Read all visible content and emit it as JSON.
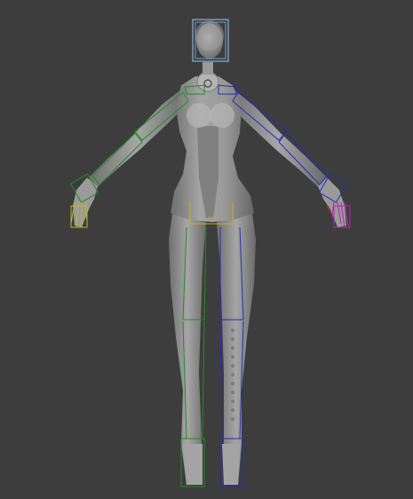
{
  "viewport": {
    "background": "#3d3d3d",
    "model_color": "#8f8f8f",
    "highlight_color": "#c9c9c9",
    "selection_color": "#8fb8e0",
    "bones": {
      "head_selected": "#9cc6f0",
      "left_side": "#1f8f1f",
      "right_side": "#2a2ab8",
      "center": "#c8b028",
      "hand_left": "#b8b82a",
      "hand_right": "#b02ab0"
    }
  }
}
